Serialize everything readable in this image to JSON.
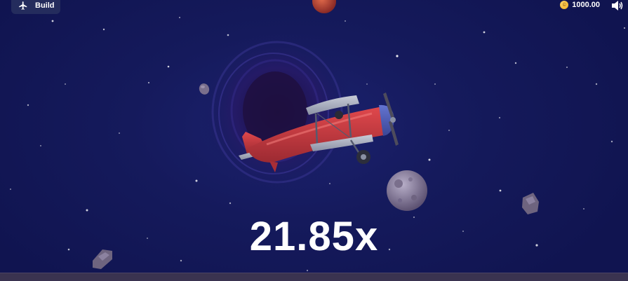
{
  "header": {
    "build_label": "Build",
    "balance": "1000.00",
    "coin_symbol": "©"
  },
  "game": {
    "multiplier": "21.85x"
  },
  "icons": {
    "build": "airplane-icon",
    "balance": "coin-icon",
    "sound": "speaker-icon"
  },
  "colors": {
    "background": "#141a55",
    "plane_body": "#c8383c",
    "plane_nose": "#4a5ab8",
    "text": "#ffffff",
    "coin": "#f0a81a"
  }
}
